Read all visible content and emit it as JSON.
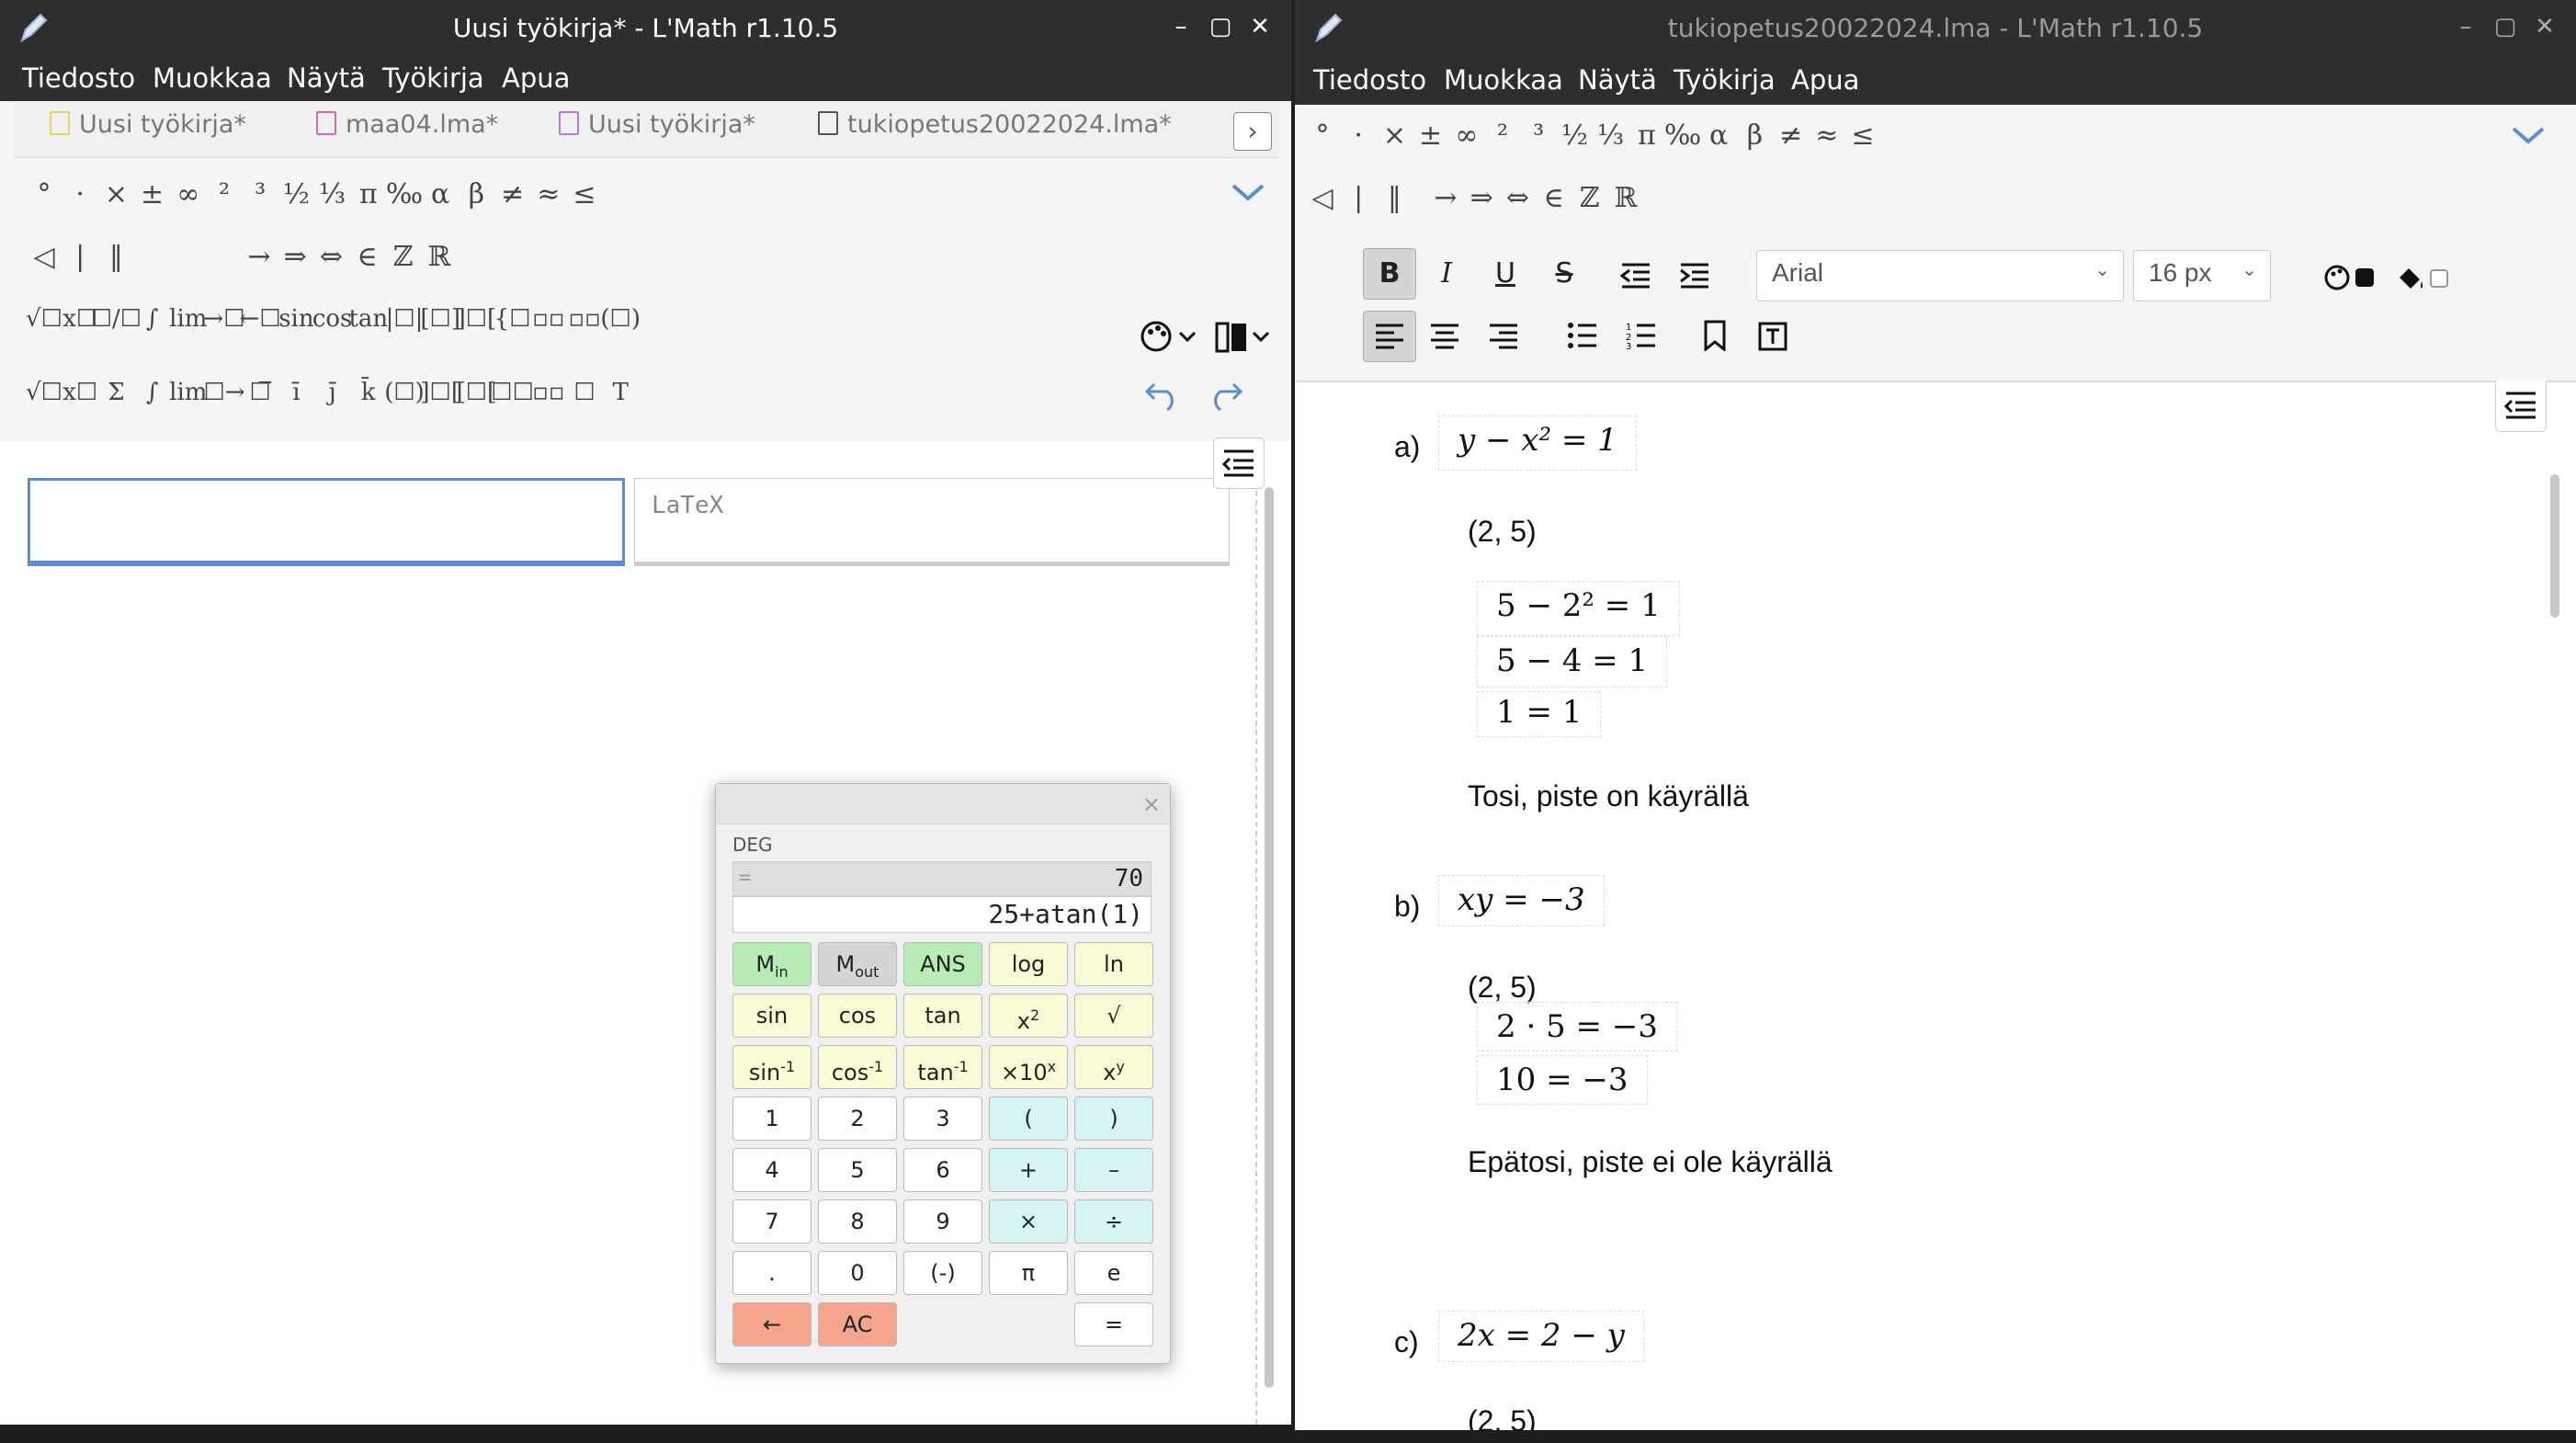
{
  "left": {
    "title": "Uusi työkirja* - L'Math r1.10.5",
    "window_buttons": [
      "–",
      "▢",
      "✕"
    ],
    "menu": [
      "Tiedosto",
      "Muokkaa",
      "Näytä",
      "Työkirja",
      "Apua"
    ],
    "tabs": [
      "Uusi työkirja*",
      "maa04.lma*",
      "Uusi työkirja*",
      "tukiopetus20022024.lma*"
    ],
    "tab_scroll": "›",
    "symbols_row1": [
      "°",
      "·",
      "×",
      "±",
      "∞",
      "²",
      "³",
      "½",
      "⅓",
      "π",
      "‰",
      "α",
      "β",
      "≠",
      "≈",
      "≤"
    ],
    "symbols_row2": [
      "◁",
      "|",
      "‖",
      "→",
      "⇒",
      "⇔",
      "∈",
      "ℤ",
      "ℝ"
    ],
    "templates_row1": [
      "√☐",
      "x☐",
      "☐/☐",
      "∫",
      "lim",
      "→☐",
      "←☐",
      "sin",
      "cos",
      "tan",
      "|☐|",
      "[☐]",
      "]☐[",
      "{☐",
      "▫▫",
      "▫▫",
      "(☐)"
    ],
    "templates_row2": [
      "√☐",
      "x☐",
      "Σ",
      "∫",
      "lim",
      "☐→",
      "☐̅",
      "ī",
      "j̄",
      "k̄",
      "(☐)",
      "]☐[",
      "[☐[",
      "☐☐",
      "▫▫",
      "☐",
      "T"
    ],
    "latex_placeholder": "LaTeX",
    "side_button": "≤",
    "bottom_text": "…"
  },
  "calculator": {
    "close": "×",
    "mode": "DEG",
    "eq_sign": "=",
    "result": "70",
    "expression": "25+atan(1)",
    "rows": [
      [
        {
          "l": "M",
          "s": "in",
          "c": "g"
        },
        {
          "l": "M",
          "s": "out",
          "c": "gr"
        },
        {
          "l": "ANS",
          "c": "g"
        },
        {
          "l": "log",
          "c": "y"
        },
        {
          "l": "ln",
          "c": "y"
        }
      ],
      [
        {
          "l": "sin",
          "c": "y"
        },
        {
          "l": "cos",
          "c": "y"
        },
        {
          "l": "tan",
          "c": "y"
        },
        {
          "l": "x",
          "p": "2",
          "c": "y"
        },
        {
          "l": "√",
          "c": "y"
        }
      ],
      [
        {
          "l": "sin",
          "p": "-1",
          "c": "y"
        },
        {
          "l": "cos",
          "p": "-1",
          "c": "y"
        },
        {
          "l": "tan",
          "p": "-1",
          "c": "y"
        },
        {
          "l": "×10",
          "p": "x",
          "c": "y"
        },
        {
          "l": "x",
          "p": "y",
          "c": "y"
        }
      ],
      [
        {
          "l": "1",
          "c": "w"
        },
        {
          "l": "2",
          "c": "w"
        },
        {
          "l": "3",
          "c": "w"
        },
        {
          "l": "(",
          "c": "c"
        },
        {
          "l": ")",
          "c": "c"
        }
      ],
      [
        {
          "l": "4",
          "c": "w"
        },
        {
          "l": "5",
          "c": "w"
        },
        {
          "l": "6",
          "c": "w"
        },
        {
          "l": "+",
          "c": "c"
        },
        {
          "l": "–",
          "c": "c"
        }
      ],
      [
        {
          "l": "7",
          "c": "w"
        },
        {
          "l": "8",
          "c": "w"
        },
        {
          "l": "9",
          "c": "w"
        },
        {
          "l": "×",
          "c": "c"
        },
        {
          "l": "÷",
          "c": "c"
        }
      ],
      [
        {
          "l": ".",
          "c": "w"
        },
        {
          "l": "0",
          "c": "w"
        },
        {
          "l": "(-)",
          "c": "w"
        },
        {
          "l": "π",
          "c": "w"
        },
        {
          "l": "e",
          "c": "w"
        }
      ],
      [
        {
          "l": "←",
          "c": "r"
        },
        {
          "l": "AC",
          "c": "r"
        },
        null,
        null,
        {
          "l": "=",
          "c": "w"
        }
      ]
    ]
  },
  "right": {
    "title": "tukiopetus20022024.lma - L'Math r1.10.5",
    "window_buttons": [
      "–",
      "▢",
      "✕"
    ],
    "menu": [
      "Tiedosto",
      "Muokkaa",
      "Näytä",
      "Työkirja",
      "Apua"
    ],
    "symbols_row1": [
      "°",
      "·",
      "×",
      "±",
      "∞",
      "²",
      "³",
      "½",
      "⅓",
      "π",
      "‰",
      "α",
      "β",
      "≠",
      "≈",
      "≤"
    ],
    "symbols_row2": [
      "◁",
      "|",
      "‖",
      "→",
      "⇒",
      "⇔",
      "∈",
      "ℤ",
      "ℝ"
    ],
    "format": {
      "bold": "B",
      "italic": "I",
      "underline": "U",
      "strike": "S",
      "font": "Arial",
      "size": "16 px"
    },
    "side_button": "≤",
    "doc": {
      "a_label": "a)",
      "a_eq": "y − x² = 1",
      "a_point": "(2, 5)",
      "a_steps": [
        "5 − 2² = 1",
        "5 − 4 = 1",
        "1 = 1"
      ],
      "a_result": "Tosi, piste on käyrällä",
      "b_label": "b)",
      "b_eq": "xy = −3",
      "b_point": "(2, 5)",
      "b_steps": [
        "2 · 5 = −3",
        "10 = −3"
      ],
      "b_result": "Epätosi, piste ei ole käyrällä",
      "c_label": "c)",
      "c_eq": "2x = 2 − y",
      "c_point": "(2, 5)"
    }
  }
}
